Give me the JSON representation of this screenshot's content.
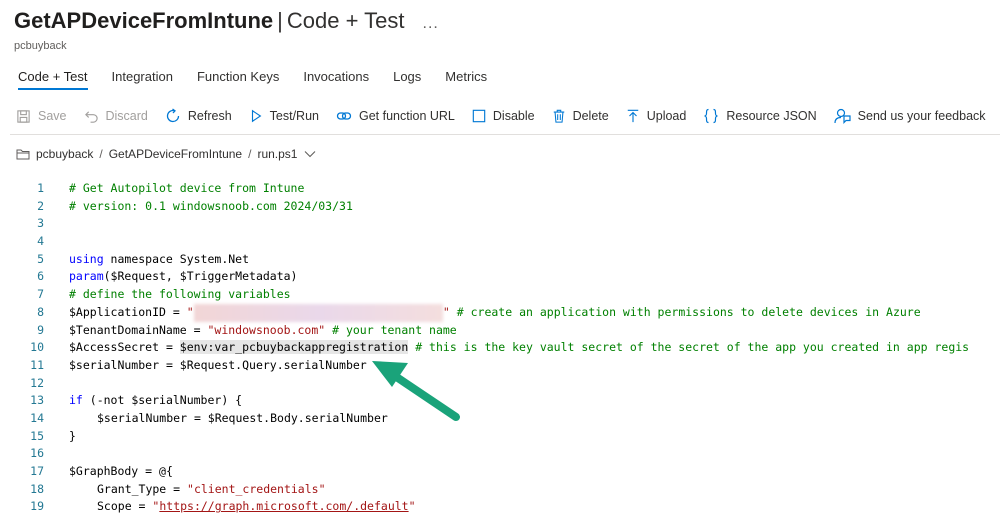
{
  "header": {
    "function_name": "GetAPDeviceFromIntune",
    "separator": "|",
    "section": "Code + Test",
    "more": "...",
    "resource": "pcbuyback"
  },
  "tabs": [
    {
      "label": "Code + Test",
      "active": true
    },
    {
      "label": "Integration"
    },
    {
      "label": "Function Keys"
    },
    {
      "label": "Invocations"
    },
    {
      "label": "Logs"
    },
    {
      "label": "Metrics"
    }
  ],
  "toolbar": {
    "save": "Save",
    "discard": "Discard",
    "refresh": "Refresh",
    "test_run": "Test/Run",
    "get_url": "Get function URL",
    "disable": "Disable",
    "delete": "Delete",
    "upload": "Upload",
    "resource_json": "Resource JSON",
    "feedback": "Send us your feedback"
  },
  "breadcrumb": {
    "app": "pcbuyback",
    "function": "GetAPDeviceFromIntune",
    "file": "run.ps1",
    "sep": "/"
  },
  "code": {
    "line_numbers": [
      "1",
      "2",
      "3",
      "4",
      "5",
      "6",
      "7",
      "8",
      "9",
      "10",
      "11",
      "12",
      "13",
      "14",
      "15",
      "16",
      "17",
      "18",
      "19"
    ],
    "l1": "# Get Autopilot device from Intune",
    "l2": "# version: 0.1 windowsnoob.com 2024/03/31",
    "l5_kw": "using",
    "l5_rest": " namespace System.Net",
    "l6_kw": "param",
    "l6_rest": "($Request, $TriggerMetadata)",
    "l7": "# define the following variables",
    "l8_var": "$ApplicationID",
    "l8_eq": " = ",
    "l8_str_open": "\"",
    "l8_redacted": "3xxxxxxx-xxxx-xxxx-xxxx-xxxxxxxxxxxx",
    "l8_str_close": "\"",
    "l8_comment": " # create an application with permissions to delete devices in Azure",
    "l9_var": "$TenantDomainName",
    "l9_eq": " = ",
    "l9_str": "\"windowsnoob.com\"",
    "l9_comment": " # your tenant name",
    "l10_var": "$AccessSecret",
    "l10_eq": " = ",
    "l10_env": "$env:var_pcbuybackappregistration",
    "l10_comment": " # this is the key vault secret of the secret of the app you created in app regis",
    "l11_var": "$serialNumber",
    "l11_eq": " = ",
    "l11_rest": "$Request.Query.serialNumber",
    "l13_kw": "if",
    "l13_rest": " (-not $serialNumber) {",
    "l14_var": "$serialNumber",
    "l14_rest": " = $Request.Body.serialNumber",
    "l15": "}",
    "l17_var": "$GraphBody",
    "l17_rest": " = @{",
    "l18_key": "Grant_Type",
    "l18_eq": " = ",
    "l18_str": "\"client_credentials\"",
    "l19_key": "Scope",
    "l19_eq": " = ",
    "l19_q1": "\"",
    "l19_url": "https://graph.microsoft.com/.default",
    "l19_q2": "\""
  },
  "colors": {
    "accent": "#0078d4",
    "arrow": "#1aa37a",
    "comment": "#008000",
    "string": "#a31515",
    "keyword": "#0000ff",
    "line_number": "#237893"
  }
}
